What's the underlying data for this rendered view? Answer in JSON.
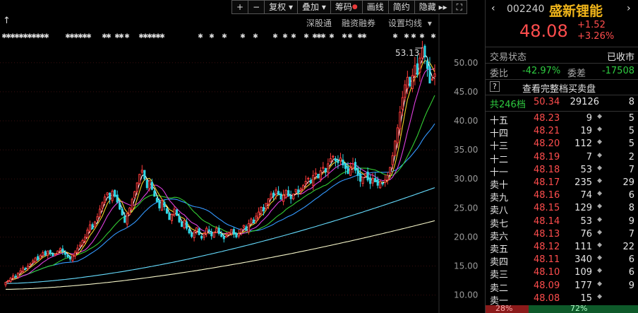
{
  "toolbar": {
    "items": [
      "+",
      "−",
      "复权",
      "叠加",
      "筹码",
      "画线",
      "简约",
      "隐藏"
    ],
    "expand_icon": "expand-icon"
  },
  "subbar": {
    "a": "深股通",
    "b": "融资融券",
    "c": "设置均线"
  },
  "panel": {
    "code": "002240",
    "name": "盛新锂能",
    "price": "48.08",
    "change": "+1.52",
    "change_pct": "+3.26%",
    "status_label": "交易状态",
    "status_value": "已收市",
    "weibi_label": "委比",
    "weibi_value": "-42.97%",
    "weicha_label": "委差",
    "weicha_value": "-17508",
    "help": "?",
    "full_book": "查看完整档买卖盘",
    "total": {
      "label": "共246档",
      "price": "50.34",
      "vol": "29126",
      "count": "8"
    },
    "asks": [
      {
        "label": "十五",
        "price": "48.23",
        "vol": "9",
        "count": "5"
      },
      {
        "label": "十四",
        "price": "48.21",
        "vol": "19",
        "count": "5"
      },
      {
        "label": "十三",
        "price": "48.20",
        "vol": "112",
        "count": "5"
      },
      {
        "label": "十二",
        "price": "48.19",
        "vol": "7",
        "count": "2"
      },
      {
        "label": "十一",
        "price": "48.18",
        "vol": "53",
        "count": "7"
      },
      {
        "label": "卖十",
        "price": "48.17",
        "vol": "235",
        "count": "29"
      },
      {
        "label": "卖九",
        "price": "48.16",
        "vol": "74",
        "count": "6"
      },
      {
        "label": "卖八",
        "price": "48.15",
        "vol": "129",
        "count": "8"
      },
      {
        "label": "卖七",
        "price": "48.14",
        "vol": "53",
        "count": "9"
      },
      {
        "label": "卖六",
        "price": "48.13",
        "vol": "76",
        "count": "7"
      },
      {
        "label": "卖五",
        "price": "48.12",
        "vol": "111",
        "count": "22"
      },
      {
        "label": "卖四",
        "price": "48.11",
        "vol": "340",
        "count": "6"
      },
      {
        "label": "卖三",
        "price": "48.10",
        "vol": "109",
        "count": "6"
      },
      {
        "label": "卖二",
        "price": "48.09",
        "vol": "177",
        "count": "9"
      },
      {
        "label": "卖一",
        "price": "48.08",
        "vol": "15",
        "count": ""
      }
    ],
    "bottom_left": "28%",
    "bottom_right": "72%"
  },
  "chart_data": {
    "type": "line",
    "series_kind": "candlestick",
    "yticks": [
      10.0,
      15.0,
      20.0,
      25.0,
      30.0,
      35.0,
      40.0,
      45.0,
      50.0
    ],
    "ylim": [
      8.5,
      53.5
    ],
    "max_label": "53.13",
    "colors": {
      "up": "#ff3b3b",
      "down": "#2fd6e6",
      "ma5": "#ffffff",
      "ma10": "#f0d22a",
      "ma20": "#e040e0",
      "ma30": "#33cc33",
      "ma60": "#3399ff",
      "ma120": "#66ddff",
      "ma250": "#f5f5c8"
    },
    "closes": [
      12.2,
      12.5,
      12.9,
      13.3,
      13.1,
      13.8,
      14.2,
      14.7,
      14.5,
      15.0,
      15.4,
      15.9,
      16.4,
      16.1,
      16.8,
      17.3,
      16.9,
      17.6,
      17.2,
      16.8,
      17.1,
      17.6,
      18.0,
      17.5,
      17.0,
      16.6,
      16.2,
      16.9,
      17.4,
      18.1,
      18.6,
      19.4,
      20.0,
      21.2,
      22.1,
      21.4,
      22.6,
      23.5,
      24.8,
      25.9,
      26.9,
      27.6,
      26.5,
      27.9,
      27.0,
      26.0,
      24.8,
      23.8,
      22.5,
      24.0,
      25.0,
      26.5,
      27.8,
      29.3,
      30.8,
      31.5,
      30.0,
      28.5,
      29.7,
      28.2,
      27.0,
      26.1,
      25.0,
      26.3,
      25.2,
      24.1,
      23.0,
      23.9,
      24.8,
      23.7,
      22.6,
      21.8,
      22.9,
      21.5,
      20.7,
      20.1,
      20.9,
      21.6,
      20.4,
      19.8,
      20.6,
      21.5,
      21.0,
      20.2,
      20.8,
      21.5,
      20.6,
      20.1,
      19.7,
      20.2,
      20.8,
      21.3,
      20.5,
      20.0,
      20.6,
      21.4,
      22.0,
      21.2,
      22.3,
      23.1,
      22.4,
      23.6,
      24.3,
      25.1,
      24.5,
      25.8,
      26.6,
      27.4,
      27.0,
      28.1,
      27.3,
      26.5,
      27.2,
      28.0,
      27.1,
      26.6,
      27.4,
      28.2,
      27.6,
      28.3,
      28.9,
      29.6,
      30.1,
      29.3,
      30.6,
      31.0,
      30.2,
      31.4,
      32.0,
      31.2,
      32.6,
      33.5,
      33.9,
      33.1,
      32.8,
      33.6,
      32.4,
      31.8,
      30.9,
      31.9,
      32.6,
      31.5,
      30.6,
      29.6,
      30.3,
      30.9,
      29.8,
      29.2,
      30.1,
      29.5,
      28.9,
      29.6,
      29.2,
      29.8,
      30.6,
      32.0,
      34.0,
      36.5,
      38.8,
      41.5,
      44.0,
      46.2,
      47.5,
      46.0,
      47.8,
      49.5,
      48.0,
      50.8,
      52.6,
      51.0,
      49.0,
      46.5,
      47.2,
      48.08
    ],
    "markers_row": "± ±± ±±± ±±± ±±±"
  }
}
